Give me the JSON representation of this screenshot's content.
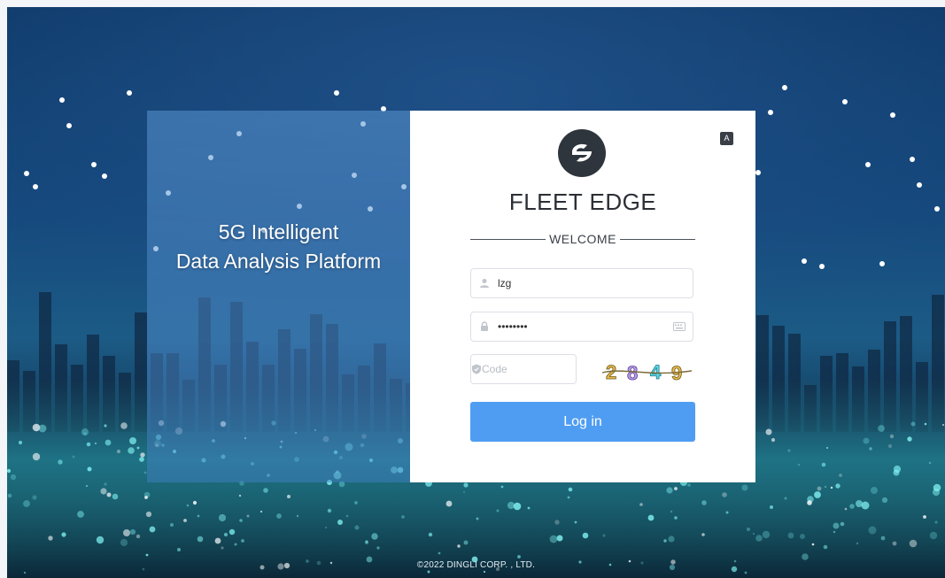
{
  "hero": {
    "line1": "5G Intelligent",
    "line2": "Data Analysis Platform"
  },
  "card": {
    "lang_label": "A",
    "brand": "FLEET EDGE",
    "welcome": "WELCOME",
    "username": {
      "value": "lzg",
      "icon": "user-icon"
    },
    "password": {
      "value": "••••••••",
      "icon": "lock-icon",
      "tail_icon": "keyboard-icon"
    },
    "code": {
      "placeholder": "Code",
      "icon": "shield-icon"
    },
    "captcha": [
      "2",
      "8",
      "4",
      "9"
    ],
    "login_label": "Log in"
  },
  "footer": "©2022 DINGLI CORP. , LTD.",
  "colors": {
    "primary": "#4f9df2",
    "logo": "#2f353d"
  }
}
